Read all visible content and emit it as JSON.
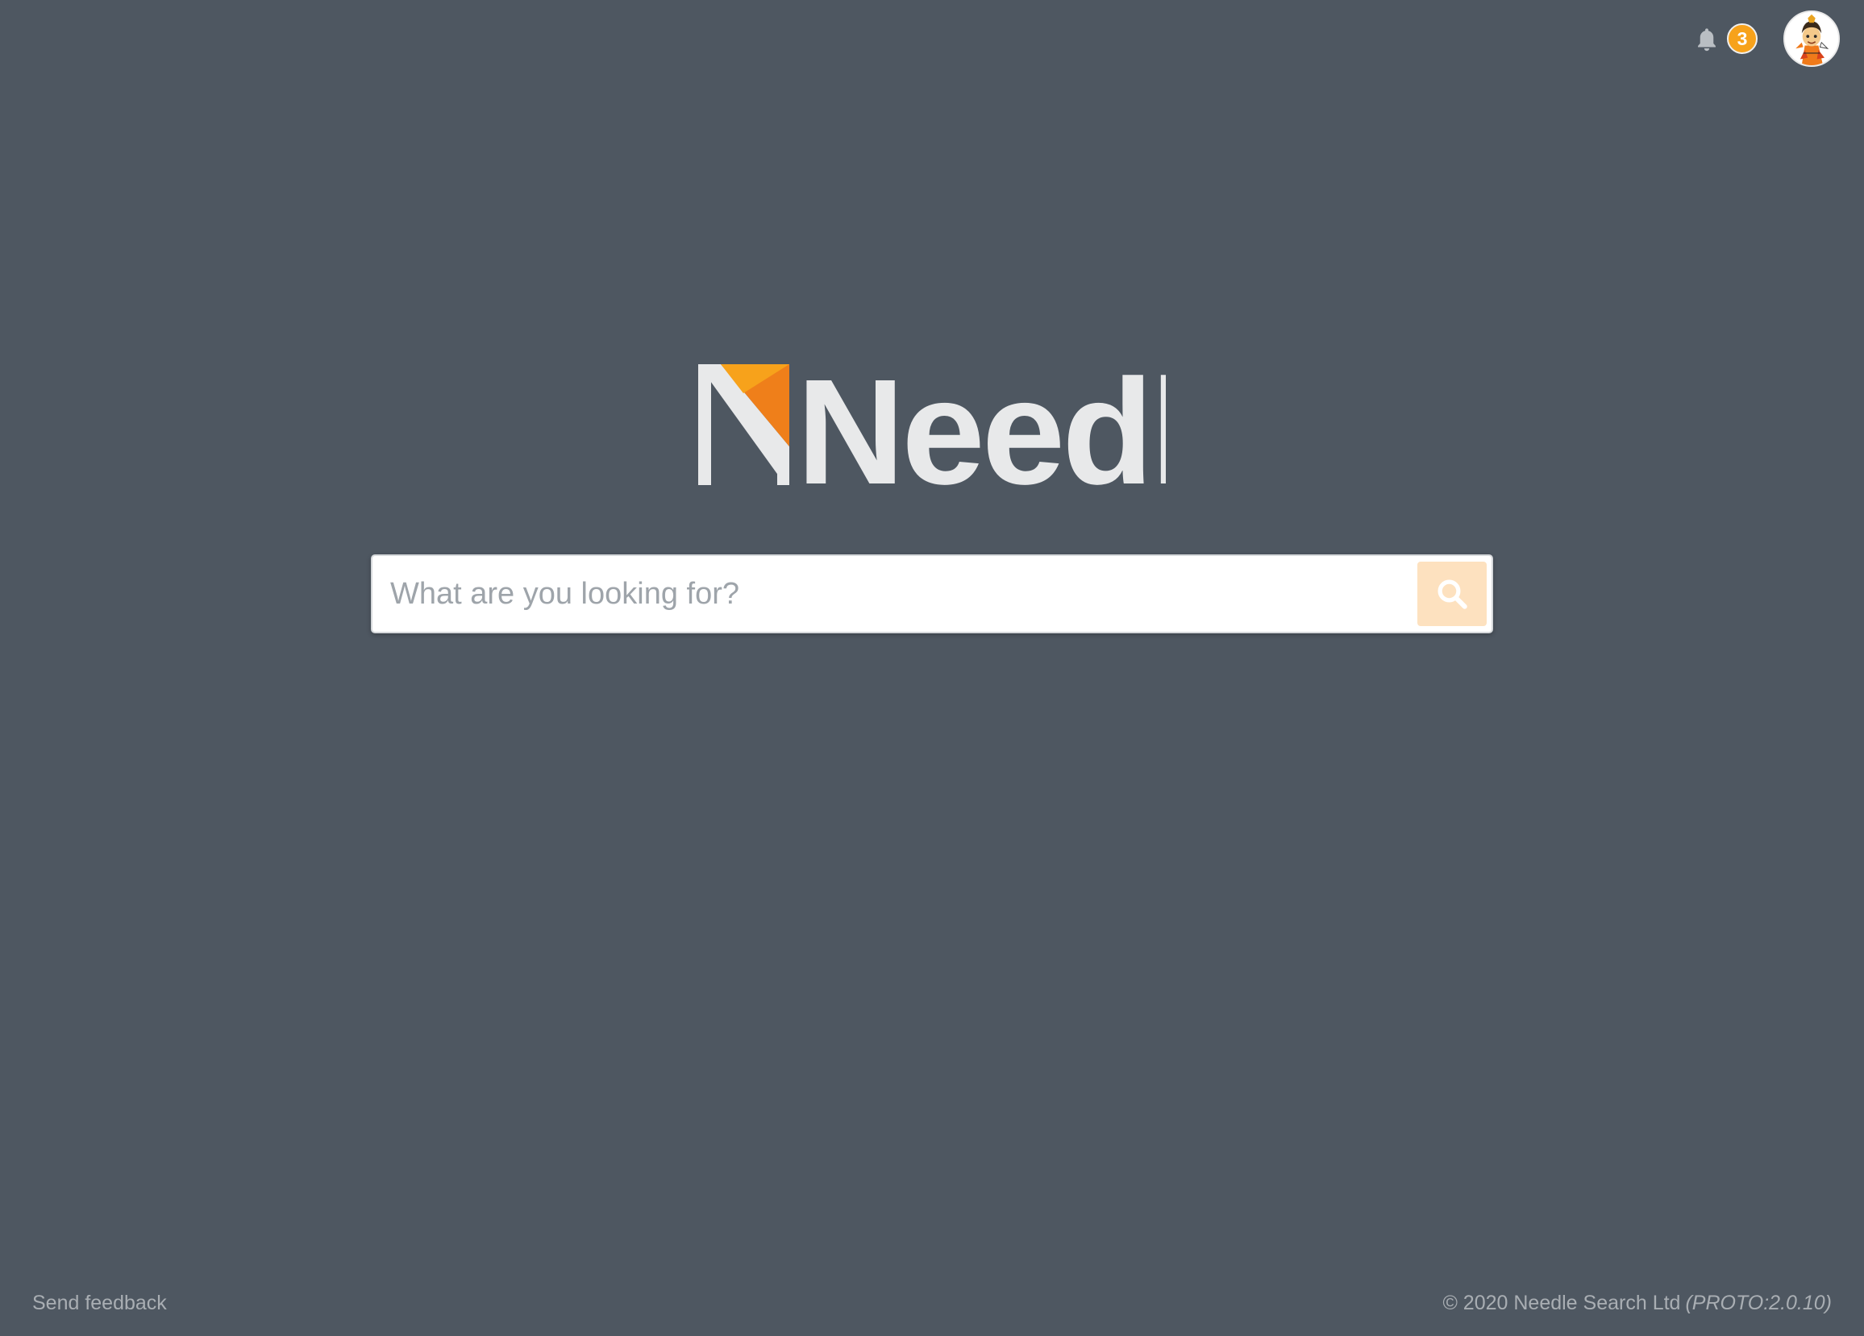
{
  "header": {
    "notifications": {
      "icon": "bell-icon",
      "count": "3",
      "badge_color": "#f7a21b"
    },
    "avatar": {
      "icon": "user-avatar"
    }
  },
  "logo": {
    "text": "Needle",
    "accent_color": "#f7a21b",
    "accent_color_dark": "#ef7f1a",
    "text_color": "#e8e9ea"
  },
  "search": {
    "placeholder": "What are you looking for?",
    "value": "",
    "button_icon": "search-icon",
    "button_color": "#fde1bf"
  },
  "footer": {
    "feedback_label": "Send feedback",
    "copyright": "© 2020 Needle Search Ltd",
    "version": "(PROTO:2.0.10)"
  },
  "theme": {
    "background": "#4e5761",
    "footer_text": "#a9aeb3"
  }
}
